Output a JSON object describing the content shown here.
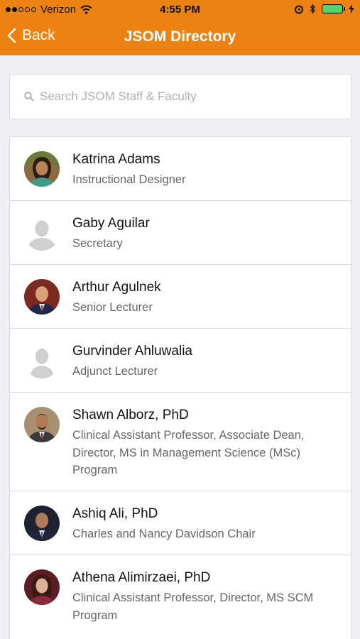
{
  "status_bar": {
    "carrier": "Verizon",
    "time": "4:55 PM"
  },
  "nav": {
    "back_label": "Back",
    "title": "JSOM Directory"
  },
  "search": {
    "placeholder": "Search JSOM Staff & Faculty",
    "value": ""
  },
  "people": [
    {
      "name": "Katrina Adams",
      "title": "Instructional Designer",
      "avatar": "photo"
    },
    {
      "name": "Gaby Aguilar",
      "title": "Secretary",
      "avatar": "placeholder"
    },
    {
      "name": "Arthur Agulnek",
      "title": "Senior Lecturer",
      "avatar": "photo"
    },
    {
      "name": "Gurvinder Ahluwalia",
      "title": "Adjunct Lecturer",
      "avatar": "placeholder"
    },
    {
      "name": "Shawn Alborz, PhD",
      "title": "Clinical Assistant Professor, Associate Dean, Director, MS in Management Science (MSc) Program",
      "avatar": "photo"
    },
    {
      "name": "Ashiq Ali, PhD",
      "title": "Charles and Nancy Davidson Chair",
      "avatar": "photo"
    },
    {
      "name": "Athena Alimirzaei, PhD",
      "title": "Clinical Assistant Professor, Director, MS SCM Program",
      "avatar": "photo"
    }
  ],
  "colors": {
    "accent": "#ec8212",
    "battery": "#4cd964"
  }
}
